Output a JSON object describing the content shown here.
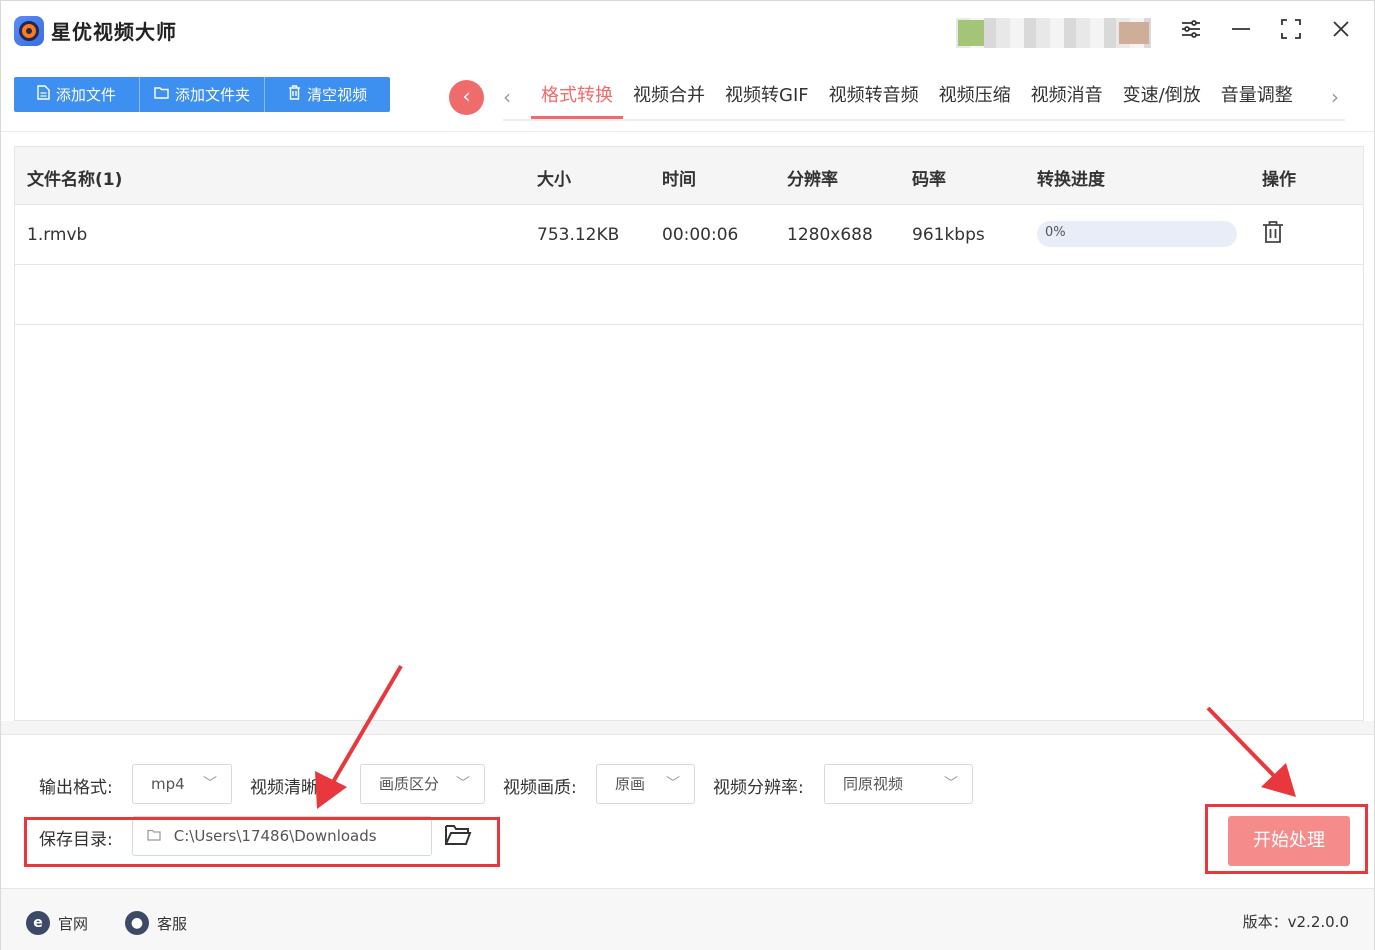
{
  "app": {
    "title": "星优视频大师"
  },
  "toolbar": {
    "add_file": "添加文件",
    "add_folder": "添加文件夹",
    "clear_videos": "清空视频"
  },
  "tabs": [
    {
      "label": "格式转换",
      "active": true
    },
    {
      "label": "视频合并"
    },
    {
      "label": "视频转GIF"
    },
    {
      "label": "视频转音频"
    },
    {
      "label": "视频压缩"
    },
    {
      "label": "视频消音"
    },
    {
      "label": "变速/倒放"
    },
    {
      "label": "音量调整"
    }
  ],
  "table": {
    "headers": {
      "name": "文件名称(1)",
      "size": "大小",
      "duration": "时间",
      "resolution": "分辨率",
      "bitrate": "码率",
      "progress": "转换进度",
      "action": "操作"
    },
    "rows": [
      {
        "name": "1.rmvb",
        "size": "753.12KB",
        "duration": "00:00:06",
        "resolution": "1280x688",
        "bitrate": "961kbps",
        "progress": "0%",
        "progress_value": 0
      }
    ]
  },
  "settings": {
    "output_format_label": "输出格式:",
    "output_format_value": "mp4",
    "clarity_label": "视频清晰度:",
    "clarity_value": "画质区分",
    "quality_label": "视频画质:",
    "quality_value": "原画",
    "resolution_label": "视频分辨率:",
    "resolution_value": "同原视频",
    "save_dir_label": "保存目录:",
    "save_dir_value": "C:\\Users\\17486\\Downloads",
    "start_button": "开始处理"
  },
  "footer": {
    "website": "官网",
    "support": "客服",
    "version": "版本：v2.2.0.0"
  },
  "colors": {
    "accent_blue": "#3d8ff0",
    "accent_red": "#f06b6b",
    "annotation_red": "#e8383d"
  }
}
